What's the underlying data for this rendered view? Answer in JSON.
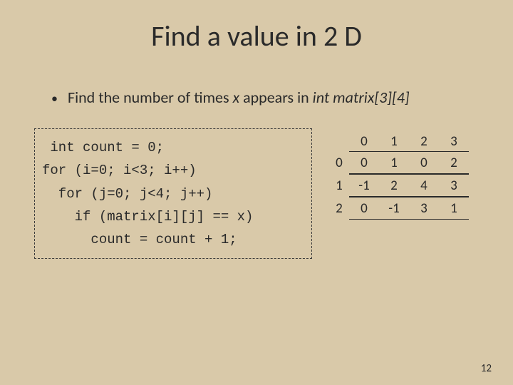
{
  "title": "Find a value in 2 D",
  "bullet": {
    "pre": "Find the number of times ",
    "x": "x",
    "mid": " appears  in ",
    "decl": "int matrix[3][4]"
  },
  "code": {
    "l1": " int count = 0;",
    "l2": "for (i=0; i<3; i++)",
    "l3": "  for (j=0; j<4; j++)",
    "l4": "    if (matrix[i][j] == x)",
    "l5": "      count = count + 1;"
  },
  "matrix": {
    "col_headers": [
      "0",
      "1",
      "2",
      "3"
    ],
    "row_headers": [
      "0",
      "1",
      "2"
    ],
    "rows": [
      [
        "0",
        "1",
        "0",
        "2"
      ],
      [
        "-1",
        "2",
        "4",
        "3"
      ],
      [
        "0",
        "-1",
        "3",
        "1"
      ]
    ]
  },
  "page_num": "12"
}
